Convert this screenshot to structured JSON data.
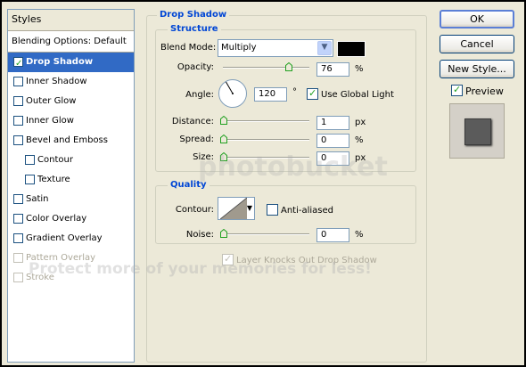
{
  "styles_panel": {
    "header": "Styles",
    "blending_options": "Blending Options: Default",
    "items": [
      {
        "label": "Drop Shadow",
        "checked": true,
        "selected": true,
        "sub": false,
        "disabled": false
      },
      {
        "label": "Inner Shadow",
        "checked": false,
        "selected": false,
        "sub": false,
        "disabled": false
      },
      {
        "label": "Outer Glow",
        "checked": false,
        "selected": false,
        "sub": false,
        "disabled": false
      },
      {
        "label": "Inner Glow",
        "checked": false,
        "selected": false,
        "sub": false,
        "disabled": false
      },
      {
        "label": "Bevel and Emboss",
        "checked": false,
        "selected": false,
        "sub": false,
        "disabled": false
      },
      {
        "label": "Contour",
        "checked": false,
        "selected": false,
        "sub": true,
        "disabled": false
      },
      {
        "label": "Texture",
        "checked": false,
        "selected": false,
        "sub": true,
        "disabled": false
      },
      {
        "label": "Satin",
        "checked": false,
        "selected": false,
        "sub": false,
        "disabled": false
      },
      {
        "label": "Color Overlay",
        "checked": false,
        "selected": false,
        "sub": false,
        "disabled": false
      },
      {
        "label": "Gradient Overlay",
        "checked": false,
        "selected": false,
        "sub": false,
        "disabled": false
      },
      {
        "label": "Pattern Overlay",
        "checked": false,
        "selected": false,
        "sub": false,
        "disabled": true
      },
      {
        "label": "Stroke",
        "checked": false,
        "selected": false,
        "sub": false,
        "disabled": true
      }
    ]
  },
  "drop_shadow": {
    "title": "Drop Shadow",
    "structure": {
      "title": "Structure",
      "blend_mode_label": "Blend Mode:",
      "blend_mode_value": "Multiply",
      "shadow_color": "#000000",
      "opacity_label": "Opacity:",
      "opacity_value": "76",
      "opacity_unit": "%",
      "opacity_level": 0.76,
      "angle_label": "Angle:",
      "angle_value": "120",
      "angle_unit": "°",
      "use_global_light_label": "Use Global Light",
      "use_global_light_checked": true,
      "distance_label": "Distance:",
      "distance_value": "1",
      "distance_unit": "px",
      "spread_label": "Spread:",
      "spread_value": "0",
      "spread_unit": "%",
      "size_label": "Size:",
      "size_value": "0",
      "size_unit": "px"
    },
    "quality": {
      "title": "Quality",
      "contour_label": "Contour:",
      "anti_aliased_label": "Anti-aliased",
      "noise_label": "Noise:",
      "noise_value": "0",
      "noise_unit": "%"
    },
    "knockout_label": "Layer Knocks Out Drop Shadow",
    "knockout_checked": true
  },
  "buttons": {
    "ok": "OK",
    "cancel": "Cancel",
    "new_style": "New Style...",
    "preview_label": "Preview",
    "preview_checked": true
  },
  "watermark": {
    "line1": "photobucket",
    "line2": "Protect more of your memories for less!"
  },
  "colors": {
    "accent": "#316ac5",
    "legend": "#0046d5",
    "dialog_bg": "#ece9d8"
  }
}
